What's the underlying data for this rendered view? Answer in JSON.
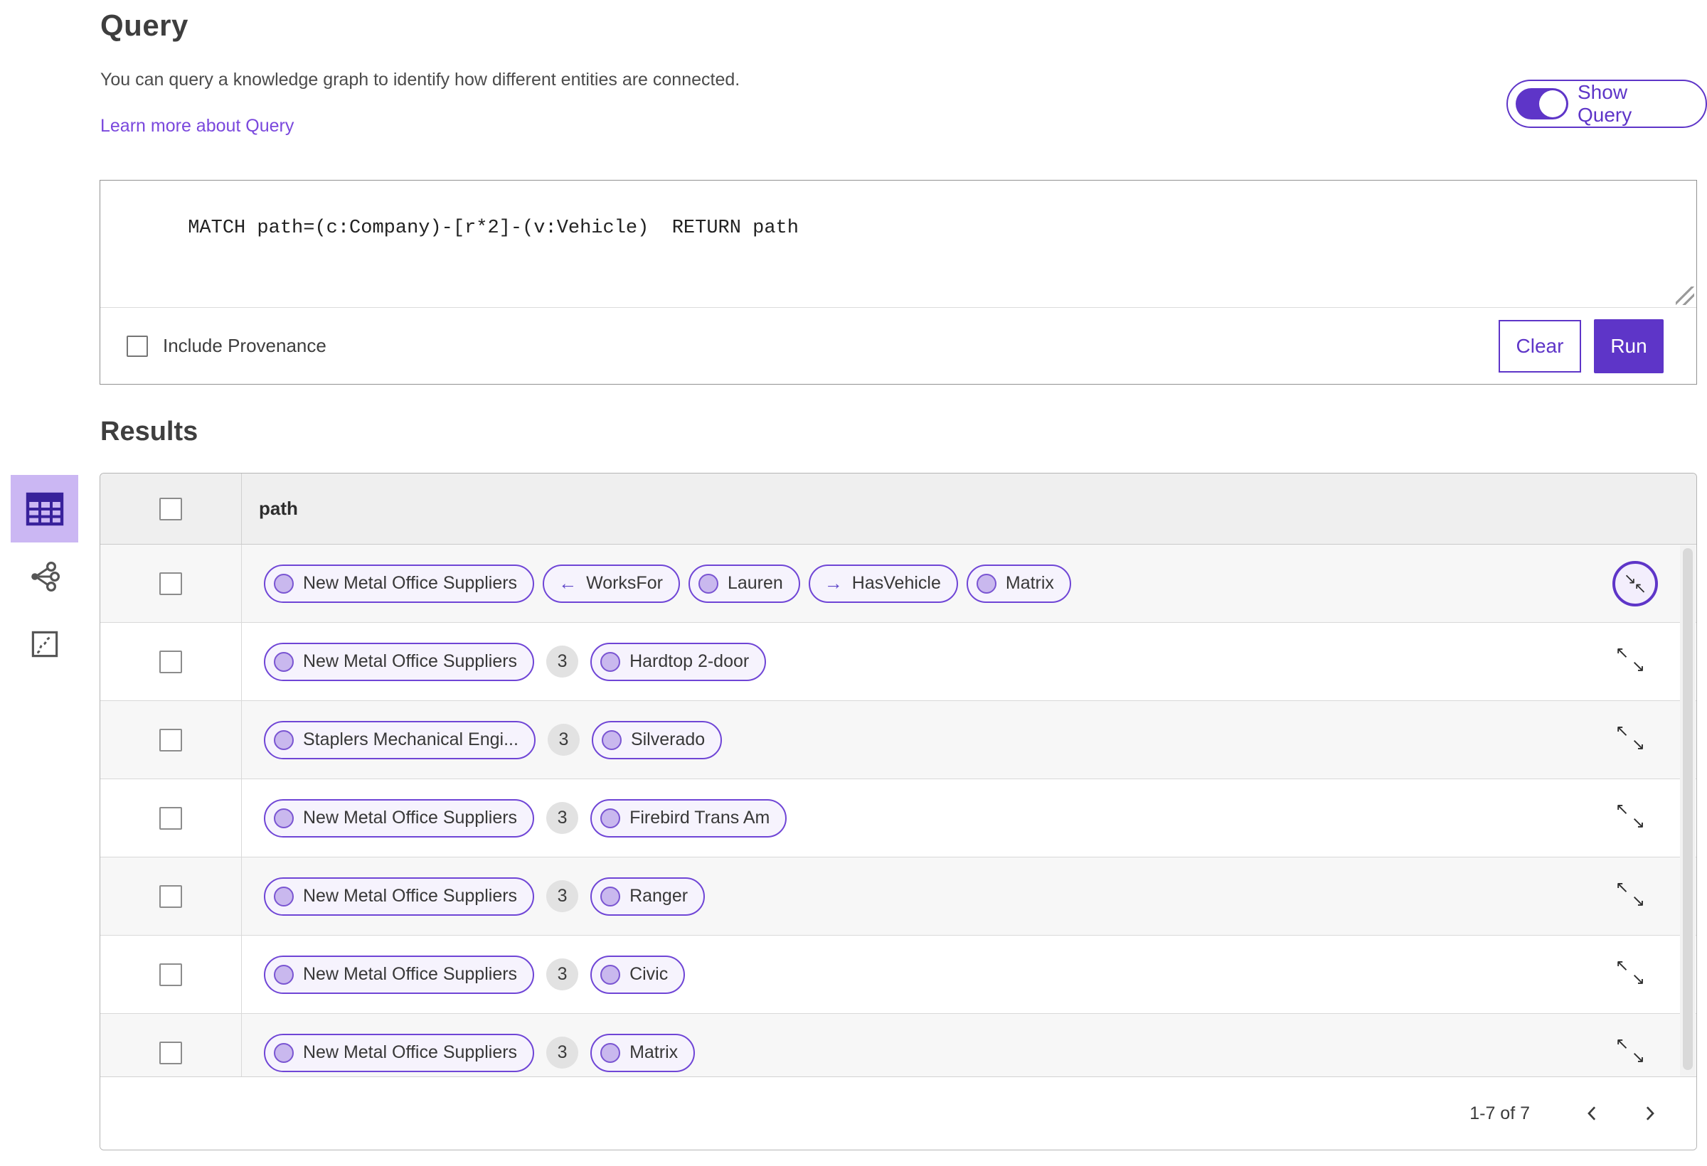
{
  "page": {
    "title": "Query",
    "description": "You can query a knowledge graph to identify how different entities are connected.",
    "learn_more": "Learn more about Query",
    "show_query_label": "Show Query",
    "show_query_on": true
  },
  "query_editor": {
    "text": "MATCH path=(c:Company)-[r*2]-(v:Vehicle)  RETURN path",
    "include_provenance_label": "Include Provenance",
    "include_provenance_checked": false,
    "clear_label": "Clear",
    "run_label": "Run"
  },
  "results": {
    "heading": "Results",
    "column_header": "path",
    "view_tabs": [
      {
        "name": "table-view",
        "icon": "table-icon",
        "selected": true
      },
      {
        "name": "graph-view",
        "icon": "share-network-icon",
        "selected": false
      },
      {
        "name": "map-view",
        "icon": "map-icon",
        "selected": false
      }
    ],
    "rows": [
      {
        "type": "expanded-path",
        "items": [
          {
            "kind": "node",
            "label": "New Metal Office Suppliers"
          },
          {
            "kind": "edge",
            "arrow": "←",
            "label": "WorksFor"
          },
          {
            "kind": "node",
            "label": "Lauren"
          },
          {
            "kind": "edge",
            "arrow": "→",
            "label": "HasVehicle"
          },
          {
            "kind": "node",
            "label": "Matrix"
          }
        ]
      },
      {
        "type": "collapsed-path",
        "start": "New Metal Office Suppliers",
        "count": "3",
        "end": "Hardtop 2-door"
      },
      {
        "type": "collapsed-path",
        "start": "Staplers Mechanical Engi...",
        "count": "3",
        "end": "Silverado"
      },
      {
        "type": "collapsed-path",
        "start": "New Metal Office Suppliers",
        "count": "3",
        "end": "Firebird Trans Am"
      },
      {
        "type": "collapsed-path",
        "start": "New Metal Office Suppliers",
        "count": "3",
        "end": "Ranger"
      },
      {
        "type": "collapsed-path",
        "start": "New Metal Office Suppliers",
        "count": "3",
        "end": "Civic"
      },
      {
        "type": "collapsed-path",
        "start": "New Metal Office Suppliers",
        "count": "3",
        "end": "Matrix"
      }
    ],
    "pagination": {
      "range_label": "1-7 of 7"
    }
  },
  "icons": {
    "expand_tl": "↖",
    "expand_br": "↘",
    "collapse_tl": "↘",
    "collapse_br": "↖"
  },
  "colors": {
    "accent_purple": "#5e35c8",
    "link_purple": "#7a48dd",
    "pill_border": "#6f45d6",
    "pill_background": "#f6f3fd",
    "node_circle_fill": "#c9b8ee",
    "selected_tab_background": "#cbb7f3",
    "table_header_background": "#efefef",
    "alternate_row_background": "#f7f7f7",
    "count_badge_background": "#e2e2e2"
  }
}
